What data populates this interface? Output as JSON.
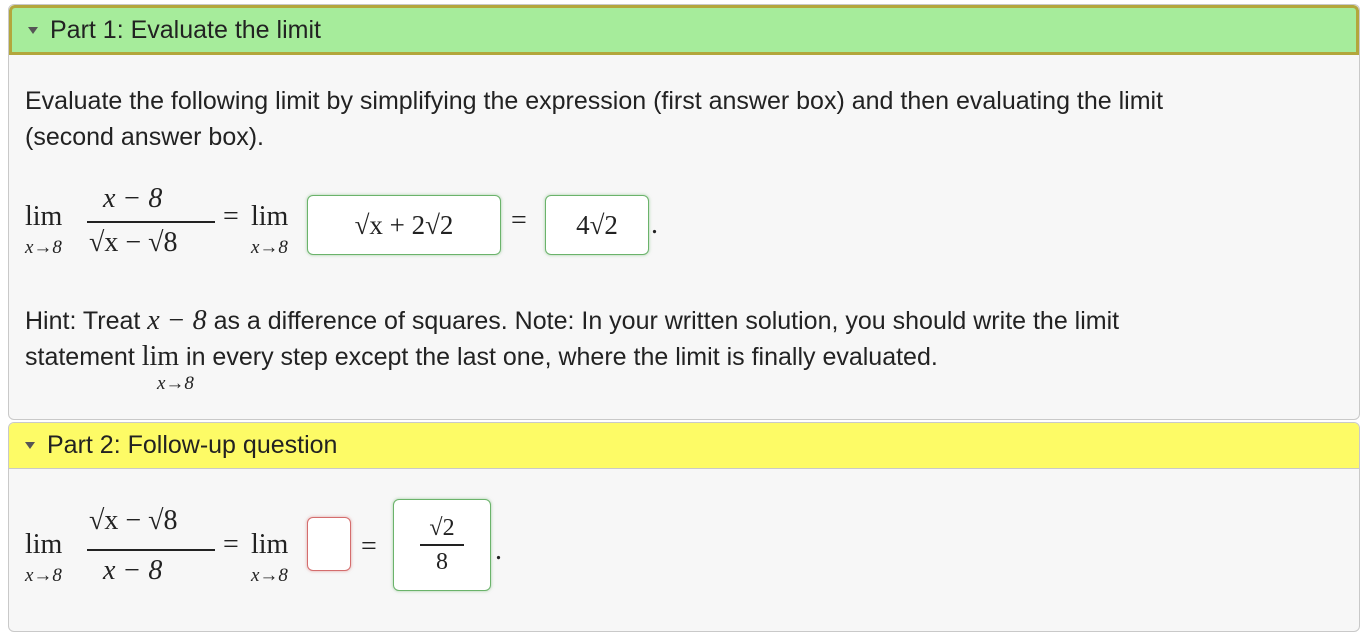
{
  "part1": {
    "header": "Part 1: Evaluate the limit",
    "instructions_line1": "Evaluate the following limit by simplifying the expression (first answer box) and then evaluating the limit",
    "instructions_line2": "(second answer box).",
    "lim_word": "lim",
    "lim_sub": "x→8",
    "numerator": "x − 8",
    "denominator": "√x − √8",
    "equals": "=",
    "answer1": "√x + 2√2",
    "answer2": "4√2",
    "period": ".",
    "hint_line1_a": "Hint: Treat",
    "hint_math": "x − 8",
    "hint_line1_b": "as a difference of squares. Note: In your written solution, you should write the limit",
    "hint_line2_a": "statement",
    "hint_line2_b": "in every step except the last one, where the limit is finally evaluated."
  },
  "part2": {
    "header": "Part 2: Follow-up question",
    "lim_word": "lim",
    "lim_sub": "x→8",
    "numerator": "√x − √8",
    "denominator": "x − 8",
    "equals": "=",
    "answer1": "",
    "answer2_num": "√2",
    "answer2_den": "8",
    "period": "."
  },
  "colors": {
    "part1_header": "#a6ec9b",
    "part2_header": "#fdfb66",
    "correct_border": "#6bb36b",
    "incorrect_border": "#d46d6d"
  }
}
